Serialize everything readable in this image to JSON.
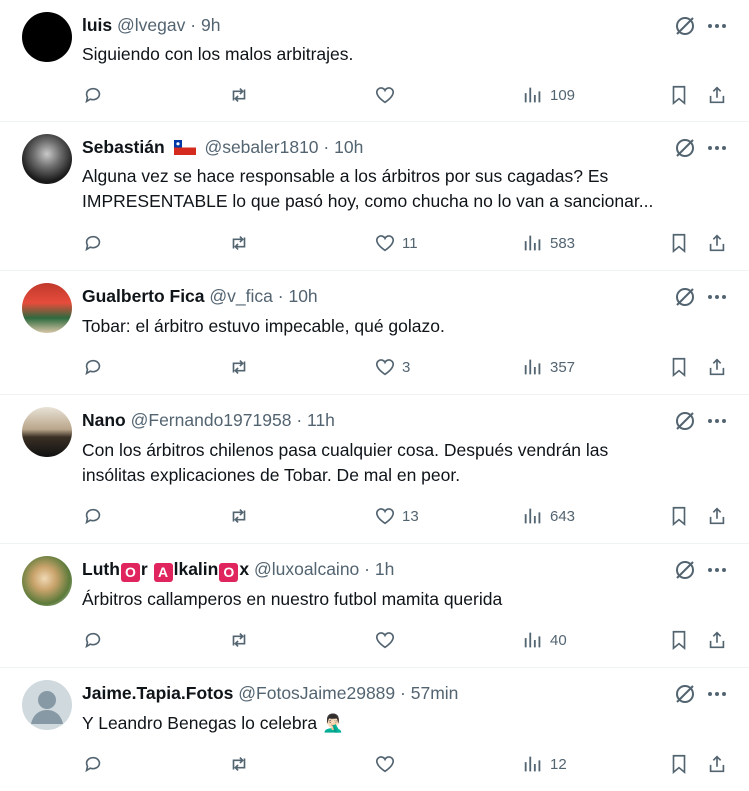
{
  "tweets": [
    {
      "name": "luis",
      "handle": "@lvegav",
      "time": "9h",
      "lines": [
        "Siguiendo con los malos arbitrajes."
      ],
      "likes": "",
      "views": "109"
    },
    {
      "name": "Sebastián",
      "handle": "@sebaler1810",
      "time": "10h",
      "flag": "chile-flag",
      "lines": [
        "Alguna vez se hace responsable a los árbitros por sus cagadas? Es",
        "IMPRESENTABLE lo que pasó hoy, como chucha no lo van a sancionar..."
      ],
      "likes": "11",
      "views": "583"
    },
    {
      "name": "Gualberto Fica",
      "handle": "@v_fica",
      "time": "10h",
      "lines": [
        "Tobar: el árbitro estuvo impecable, qué golazo."
      ],
      "likes": "3",
      "views": "357"
    },
    {
      "name": "Nano",
      "handle": "@Fernando1971958",
      "time": "11h",
      "lines": [
        "Con los árbitros chilenos pasa cualquier cosa. Después vendrán las",
        "insólitas explicaciones de Tobar. De mal en peor."
      ],
      "likes": "13",
      "views": "643"
    },
    {
      "name_parts": [
        "Luth",
        "O",
        "r ",
        "A",
        "lkalin",
        "O",
        "x"
      ],
      "handle": "@luxoalcaino",
      "time": "1h",
      "lines": [
        "Árbitros callamperos en nuestro futbol mamita querida"
      ],
      "likes": "",
      "views": "40"
    },
    {
      "name": "Jaime.Tapia.Fotos",
      "handle": "@FotosJaime29889",
      "time": "57min",
      "lines": [
        "Y Leandro Benegas lo celebra 🤦🏻‍♂️"
      ],
      "likes": "",
      "views": "12"
    }
  ],
  "separator": "·",
  "icons": {
    "reply": "reply-icon",
    "retweet": "retweet-icon",
    "like": "heart-icon",
    "views": "views-icon",
    "bookmark": "bookmark-icon",
    "share": "share-icon",
    "grok": "grok-icon",
    "more": "more-icon"
  }
}
